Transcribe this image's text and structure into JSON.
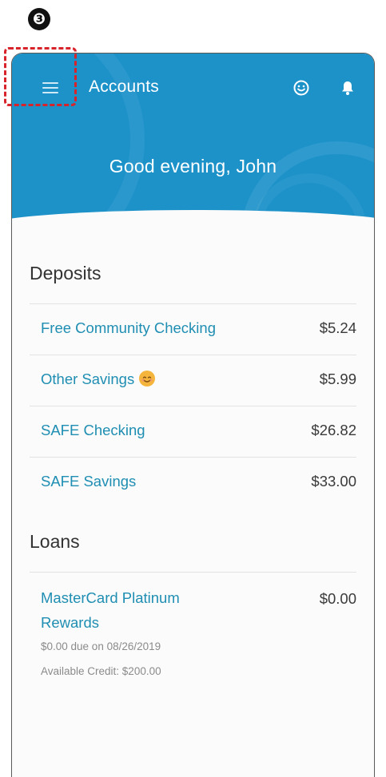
{
  "step_marker": "❸",
  "header": {
    "title": "Accounts",
    "greeting": "Good evening, John",
    "menu_icon": "hamburger-menu-icon",
    "smile_icon": "smile-icon",
    "bell_icon": "bell-icon",
    "bg_color": "#1d92c9"
  },
  "deposits": {
    "title": "Deposits",
    "items": [
      {
        "name": "Free Community Checking",
        "amount": "$5.24"
      },
      {
        "name": "Other Savings",
        "amount": "$5.99",
        "emoji": "smiling-face-emoji"
      },
      {
        "name": "SAFE Checking",
        "amount": "$26.82"
      },
      {
        "name": "SAFE Savings",
        "amount": "$33.00"
      }
    ]
  },
  "loans": {
    "title": "Loans",
    "items": [
      {
        "name": "MasterCard Platinum Rewards",
        "amount": "$0.00",
        "due": "$0.00 due on 08/26/2019",
        "credit": "Available Credit: $200.00"
      }
    ]
  },
  "colors": {
    "accent": "#1f8eb2",
    "highlight": "#d8232a"
  }
}
